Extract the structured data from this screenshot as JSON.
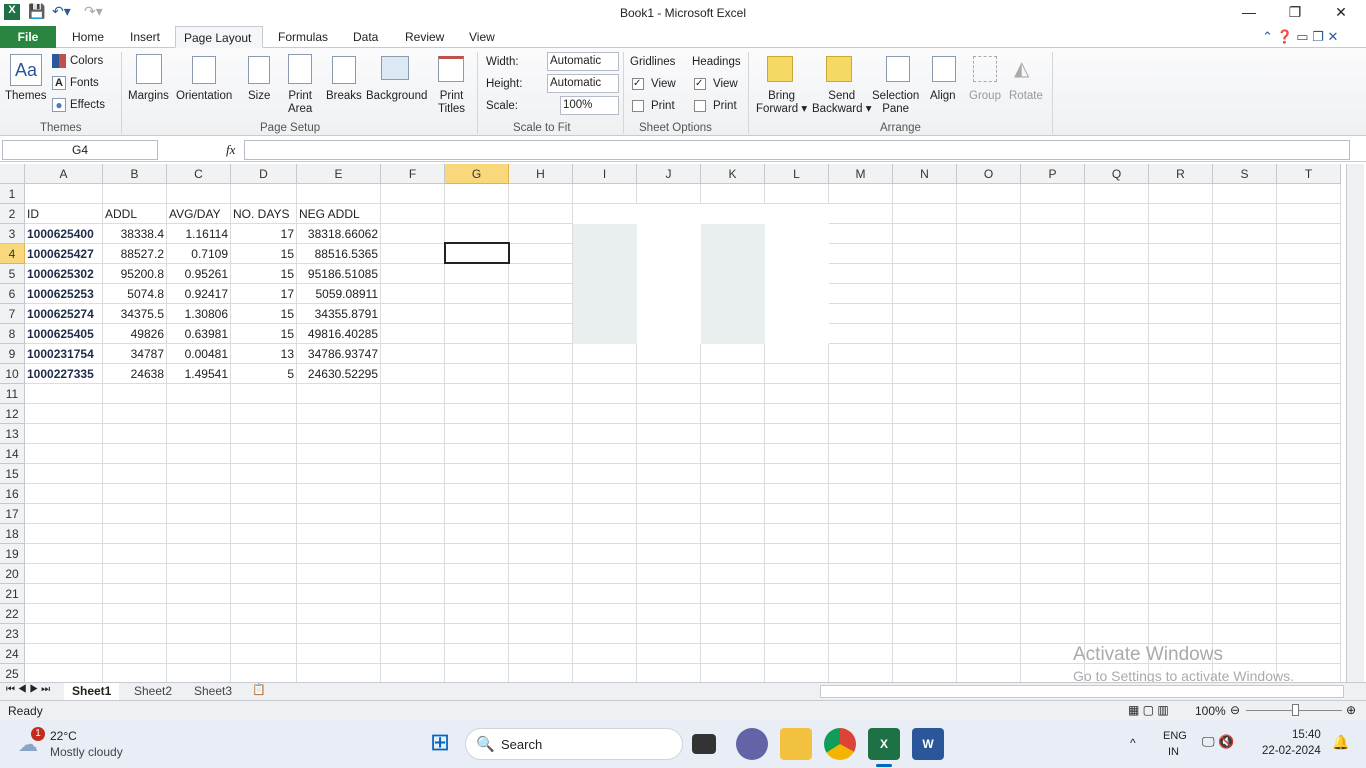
{
  "window": {
    "title": "Book1 - Microsoft Excel"
  },
  "tabs": [
    "File",
    "Home",
    "Insert",
    "Page Layout",
    "Formulas",
    "Data",
    "Review",
    "View"
  ],
  "ribbon": {
    "themes": {
      "themes": "Themes",
      "colors": "Colors",
      "fonts": "Fonts",
      "effects": "Effects",
      "group": "Themes"
    },
    "page_setup": {
      "margins": "Margins",
      "orientation": "Orientation",
      "size": "Size",
      "print_area_1": "Print",
      "print_area_2": "Area",
      "breaks": "Breaks",
      "background": "Background",
      "print_titles_1": "Print",
      "print_titles_2": "Titles",
      "group": "Page Setup"
    },
    "scale": {
      "width_label": "Width:",
      "width_value": "Automatic",
      "height_label": "Height:",
      "height_value": "Automatic",
      "scale_label": "Scale:",
      "scale_value": "100%",
      "group": "Scale to Fit"
    },
    "sheet_options": {
      "gridlines": "Gridlines",
      "headings": "Headings",
      "view": "View",
      "print": "Print",
      "group": "Sheet Options"
    },
    "arrange": {
      "bring_1": "Bring",
      "bring_2": "Forward",
      "send_1": "Send",
      "send_2": "Backward",
      "sel_1": "Selection",
      "sel_2": "Pane",
      "align": "Align",
      "group_btn": "Group",
      "rotate": "Rotate",
      "group": "Arrange"
    }
  },
  "formula_bar": {
    "name_box": "G4",
    "fx": "fx",
    "value": ""
  },
  "columns": [
    "A",
    "B",
    "C",
    "D",
    "E",
    "F",
    "G",
    "H",
    "I",
    "J",
    "K",
    "L",
    "M",
    "N",
    "O",
    "P",
    "Q",
    "R",
    "S",
    "T"
  ],
  "rows": [
    [],
    [
      "ID",
      "ADDL",
      "AVG/DAY",
      "NO. DAYS",
      "NEG ADDL"
    ],
    [
      "1000625400",
      "38338.4",
      "1.16114",
      "17",
      "38318.66062"
    ],
    [
      "1000625427",
      "88527.2",
      "0.7109",
      "15",
      "88516.5365"
    ],
    [
      "1000625302",
      "95200.8",
      "0.95261",
      "15",
      "95186.51085"
    ],
    [
      "1000625253",
      "5074.8",
      "0.92417",
      "17",
      "5059.08911"
    ],
    [
      "1000625274",
      "34375.5",
      "1.30806",
      "15",
      "34355.8791"
    ],
    [
      "1000625405",
      "49826",
      "0.63981",
      "15",
      "49816.40285"
    ],
    [
      "1000231754",
      "34787",
      "0.00481",
      "13",
      "34786.93747"
    ],
    [
      "1000227335",
      "24638",
      "1.49541",
      "5",
      "24630.52295"
    ]
  ],
  "row_count": 25,
  "sheets": [
    "Sheet1",
    "Sheet2",
    "Sheet3"
  ],
  "status": {
    "ready": "Ready",
    "zoom": "100%"
  },
  "watermark": {
    "line1": "Activate Windows",
    "line2": "Go to Settings to activate Windows."
  },
  "taskbar": {
    "temp": "22°C",
    "weather": "Mostly cloudy",
    "badge": "1",
    "search": "Search",
    "lang1": "ENG",
    "lang2": "IN",
    "time": "15:40",
    "date": "22-02-2024"
  }
}
